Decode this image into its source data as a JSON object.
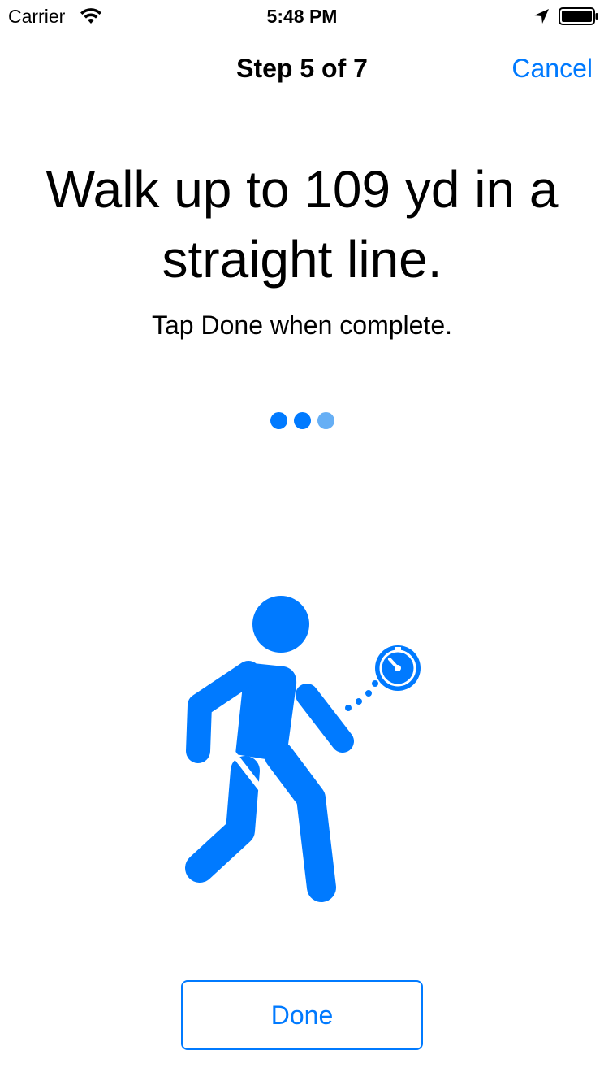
{
  "status_bar": {
    "carrier": "Carrier",
    "time": "5:48 PM",
    "icons": [
      "wifi-icon",
      "location-arrow-icon",
      "battery-icon"
    ]
  },
  "nav": {
    "title": "Step 5 of 7",
    "cancel_label": "Cancel"
  },
  "step": {
    "title": "Walk up to 109 yd in a straight line.",
    "detail": "Tap Done when complete.",
    "progress_dots": {
      "total": 3,
      "active": 2
    },
    "illustration": "walking-person-with-timer-icon"
  },
  "done_label": "Done",
  "colors": {
    "accent": "#007aff",
    "dot_inactive": "#66aff5",
    "text": "#000000",
    "background": "#ffffff"
  }
}
